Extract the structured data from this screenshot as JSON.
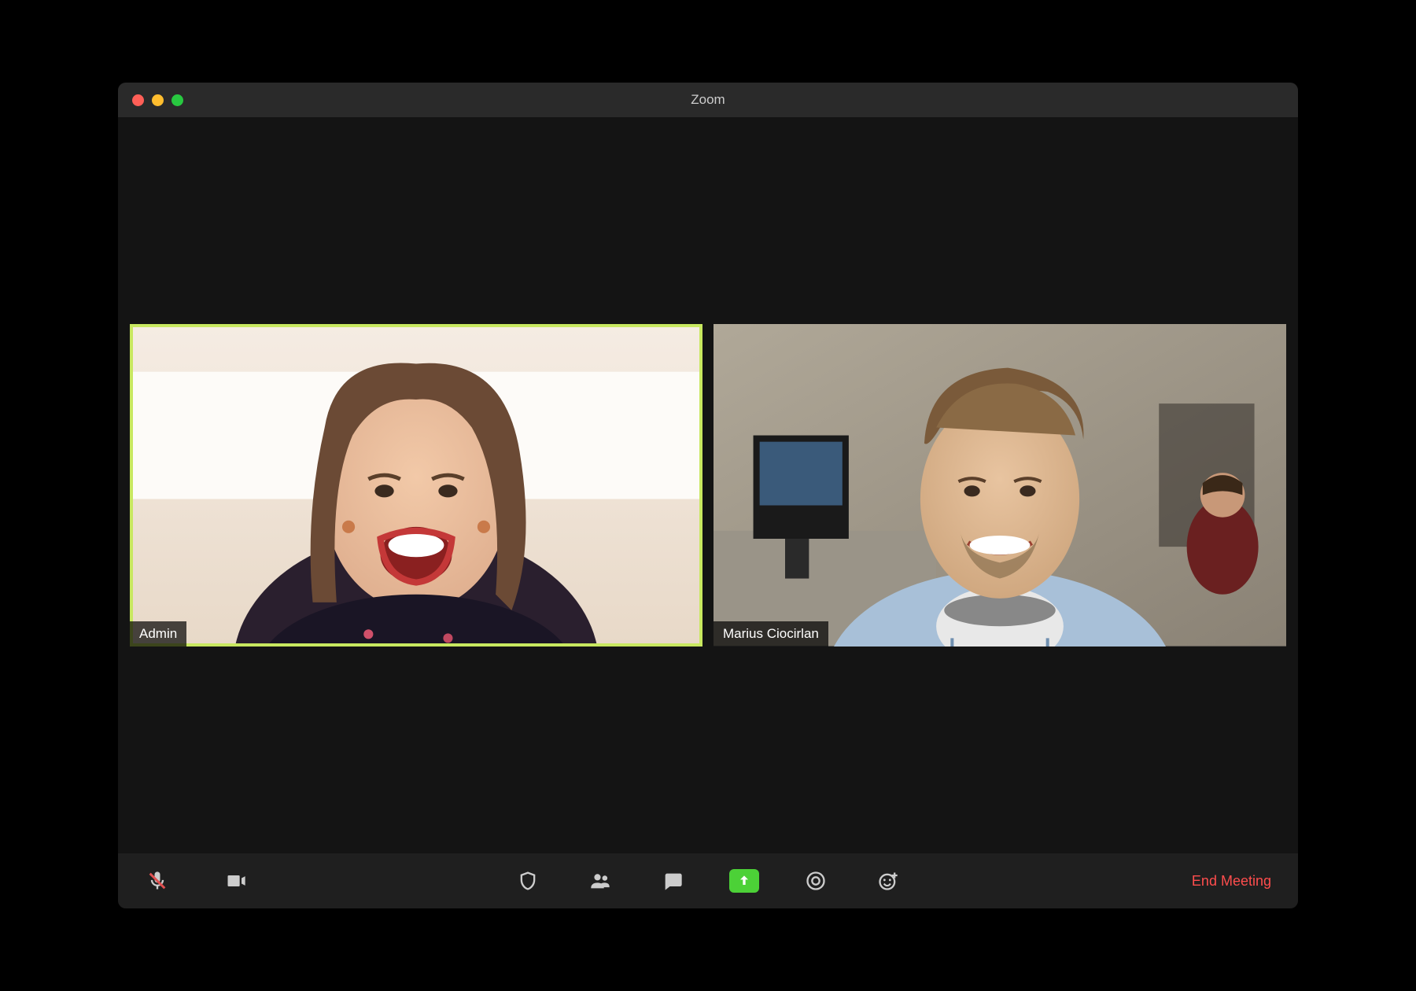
{
  "window": {
    "title": "Zoom"
  },
  "participants": [
    {
      "name": "Admin",
      "active": true
    },
    {
      "name": "Marius Ciocirlan",
      "active": false
    }
  ],
  "toolbar": {
    "mute_label": "Mute",
    "video_label": "Video",
    "security_label": "Security",
    "participants_label": "Participants",
    "chat_label": "Chat",
    "share_label": "Share Screen",
    "record_label": "Record",
    "reactions_label": "Reactions",
    "end_label": "End Meeting"
  },
  "colors": {
    "active_border": "#c8e860",
    "end_meeting": "#ff4d4d",
    "share_bg": "#4cd137"
  }
}
